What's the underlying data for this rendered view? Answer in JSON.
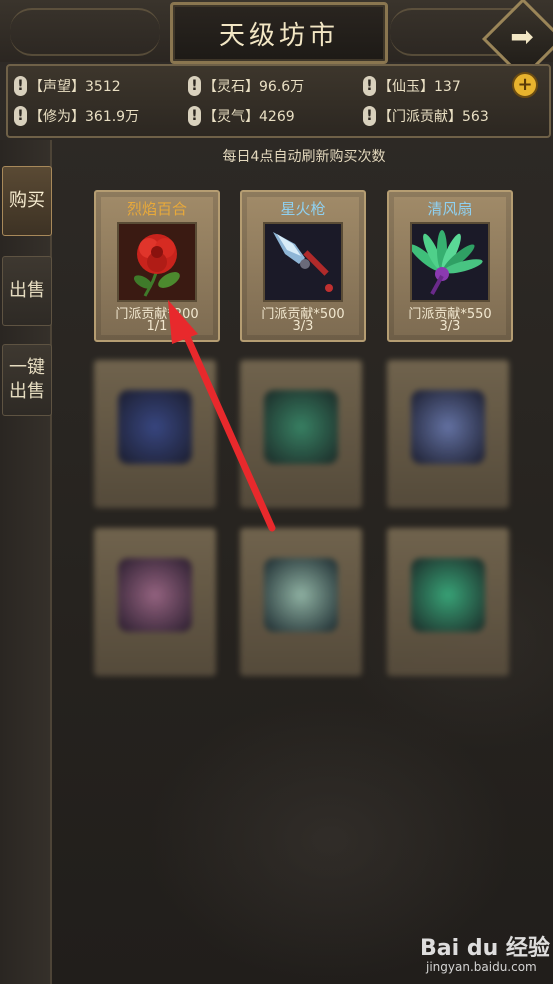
{
  "header": {
    "title": "天级坊市",
    "exit_icon": "arrow-right-icon"
  },
  "stats": [
    {
      "label": "【声望】3512"
    },
    {
      "label": "【灵石】96.6万"
    },
    {
      "label": "【仙玉】137"
    },
    {
      "label": "【修为】361.9万"
    },
    {
      "label": "【灵气】4269"
    },
    {
      "label": "【门派贡献】563"
    }
  ],
  "plus_label": "+",
  "tabs": [
    {
      "label": "购买",
      "active": true
    },
    {
      "label": "出售",
      "active": false
    },
    {
      "label": "一键出售",
      "active": false
    }
  ],
  "notice": "每日4点自动刷新购买次数",
  "items": [
    {
      "name": "烈焰百合",
      "price": "门派贡献*200",
      "count": "1/1",
      "name_color": "#e8a93a",
      "icon": "red-flower-icon"
    },
    {
      "name": "星火枪",
      "price": "门派贡献*500",
      "count": "3/3",
      "name_color": "#8fd0f0",
      "icon": "spear-icon"
    },
    {
      "name": "清风扇",
      "price": "门派贡献*550",
      "count": "3/3",
      "name_color": "#8fd0f0",
      "icon": "feather-fan-icon"
    }
  ],
  "watermark": {
    "logo": "Bai du 经验",
    "url": "jingyan.baidu.com"
  }
}
